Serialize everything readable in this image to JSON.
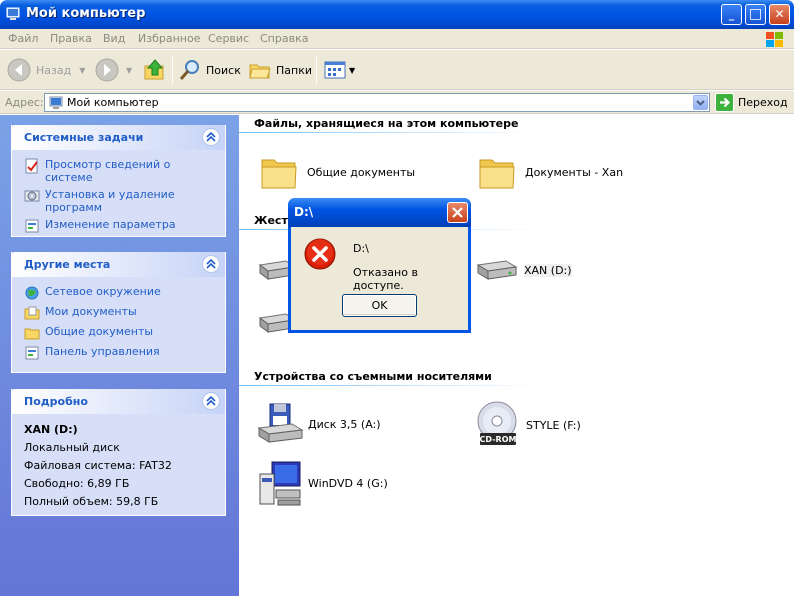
{
  "window": {
    "title": "Мой компьютер",
    "minimize_glyph": "_",
    "maximize_glyph": "□",
    "close_glyph": "✕"
  },
  "menu": [
    "Файл",
    "Правка",
    "Вид",
    "Избранное",
    "Сервис",
    "Справка"
  ],
  "toolbar": {
    "back_label": "Назад",
    "search_label": "Поиск",
    "folders_label": "Папки"
  },
  "address": {
    "label": "Адрес:",
    "value": "Мой компьютер",
    "go_label": "Переход"
  },
  "panels": {
    "system_tasks": {
      "title": "Системные задачи",
      "items": [
        "Просмотр сведений о системе",
        "Установка и удаление программ",
        "Изменение параметра"
      ]
    },
    "other_places": {
      "title": "Другие места",
      "items": [
        "Сетевое окружение",
        "Мои документы",
        "Общие документы",
        "Панель управления"
      ]
    },
    "details": {
      "title": "Подробно",
      "name": "XAN (D:)",
      "type": "Локальный диск",
      "filesystem": "Файловая система: FAT32",
      "free": "Свободно: 6,89 ГБ",
      "total": "Полный объем: 59,8 ГБ"
    }
  },
  "groups": {
    "files": {
      "title": "Файлы, хранящиеся на этом компьютере",
      "items": [
        "Общие документы",
        "Документы - Xan"
      ]
    },
    "hard_disks": {
      "title": "Жест",
      "items": [
        "XAN (D:)"
      ]
    },
    "removable": {
      "title": "Устройства со съемными носителями",
      "items": [
        "Диск 3,5 (A:)",
        "STYLE (F:)",
        "WinDVD 4 (G:)"
      ]
    }
  },
  "dialog": {
    "title": "D:\\",
    "line1": "D:\\",
    "line2": "Отказано в доступе.",
    "ok_label": "OK",
    "cdrom_badge": "CD-ROM"
  },
  "colors": {
    "titlebar": "#0054e3",
    "taskpane_link": "#215dc6",
    "taskpane_bg": "#7ba2e7",
    "error_red": "#d81e06"
  }
}
